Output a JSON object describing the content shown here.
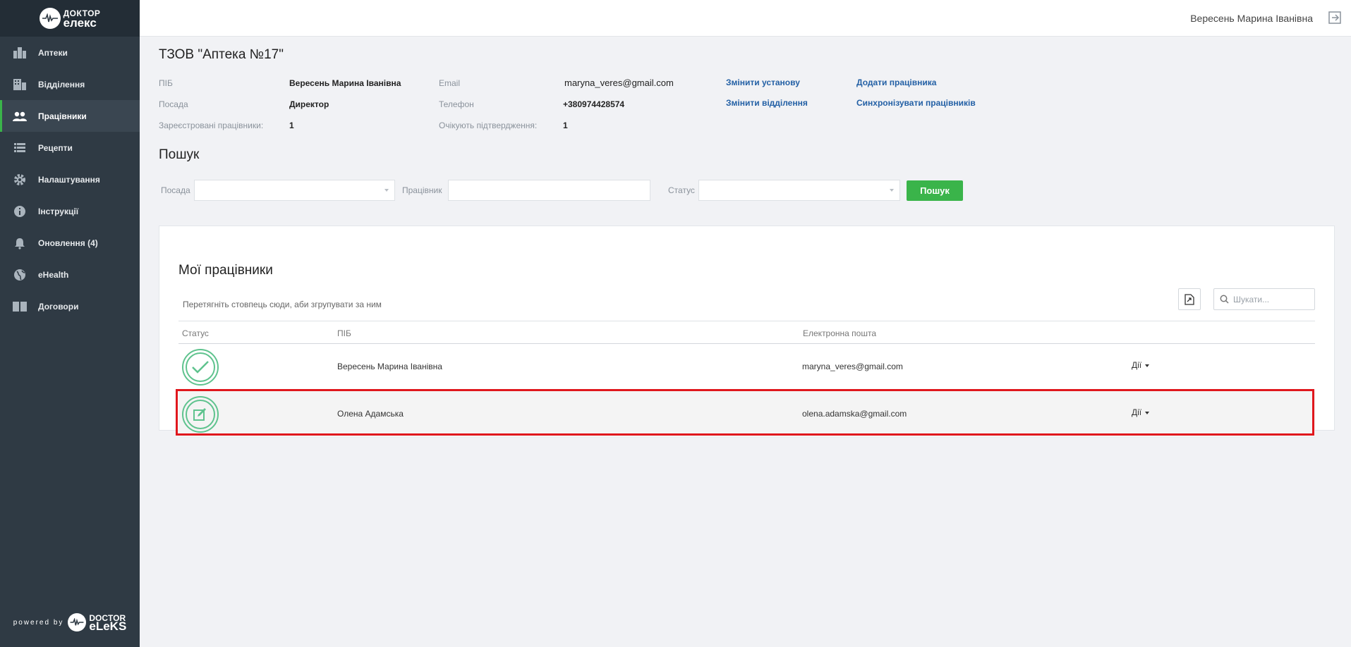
{
  "brand": {
    "line1": "ДОКТОР",
    "line2": "елекс"
  },
  "sidebar": {
    "items": [
      {
        "label": "Аптеки",
        "icon": "pharmacy-building-icon"
      },
      {
        "label": "Відділення",
        "icon": "department-building-icon"
      },
      {
        "label": "Працівники",
        "icon": "users-icon",
        "active": true
      },
      {
        "label": "Рецепти",
        "icon": "list-icon"
      },
      {
        "label": "Налаштування",
        "icon": "gear-icon"
      },
      {
        "label": "Інструкції",
        "icon": "info-icon"
      },
      {
        "label": "Оновлення (4)",
        "icon": "bell-icon"
      },
      {
        "label": "eHealth",
        "icon": "globe-icon"
      },
      {
        "label": "Договори",
        "icon": "book-icon"
      }
    ],
    "footer": {
      "powered": "powered by",
      "line1": "DOCTOR",
      "line2": "eLeKS"
    }
  },
  "header": {
    "user_name": "Вересень Марина Іванівна"
  },
  "org": {
    "title": "ТЗОВ \"Аптека №17\"",
    "fio_label": "ПІБ",
    "fio_value": "Вересень Марина Іванівна",
    "position_label": "Посада",
    "position_value": "Директор",
    "registered_label": "Зареєстровані працівники:",
    "registered_value": "1",
    "email_label": "Email",
    "email_value": "maryna_veres@gmail.com",
    "phone_label": "Телефон",
    "phone_value": "+380974428574",
    "pending_label": "Очікують підтвердження:",
    "pending_value": "1",
    "links": {
      "change_institution": "Змінити установу",
      "change_department": "Змінити відділення",
      "add_employee": "Додати працівника",
      "sync_employees": "Синхронізувати працівників"
    }
  },
  "search": {
    "title": "Пошук",
    "position_label": "Посада",
    "employee_label": "Працівник",
    "status_label": "Статус",
    "button": "Пошук"
  },
  "employees": {
    "title": "Мої працівники",
    "group_hint": "Перетягніть стовпець сюди, аби згрупувати за ним",
    "search_placeholder": "Шукати...",
    "columns": {
      "status": "Статус",
      "name": "ПІБ",
      "email": "Електронна пошта"
    },
    "rows": [
      {
        "status": "confirmed",
        "status_icon": "check-icon",
        "name": "Вересень Марина Іванівна",
        "email": "maryna_veres@gmail.com",
        "actions": "Дії"
      },
      {
        "status": "pending",
        "status_icon": "edit-icon",
        "name": "Олена Адамська",
        "email": "olena.adamska@gmail.com",
        "actions": "Дії",
        "highlighted": true
      }
    ]
  },
  "colors": {
    "sidebar": "#2f3a44",
    "accent": "#3ab44a",
    "link": "#2360a5",
    "highlight_border": "#e0171d"
  }
}
